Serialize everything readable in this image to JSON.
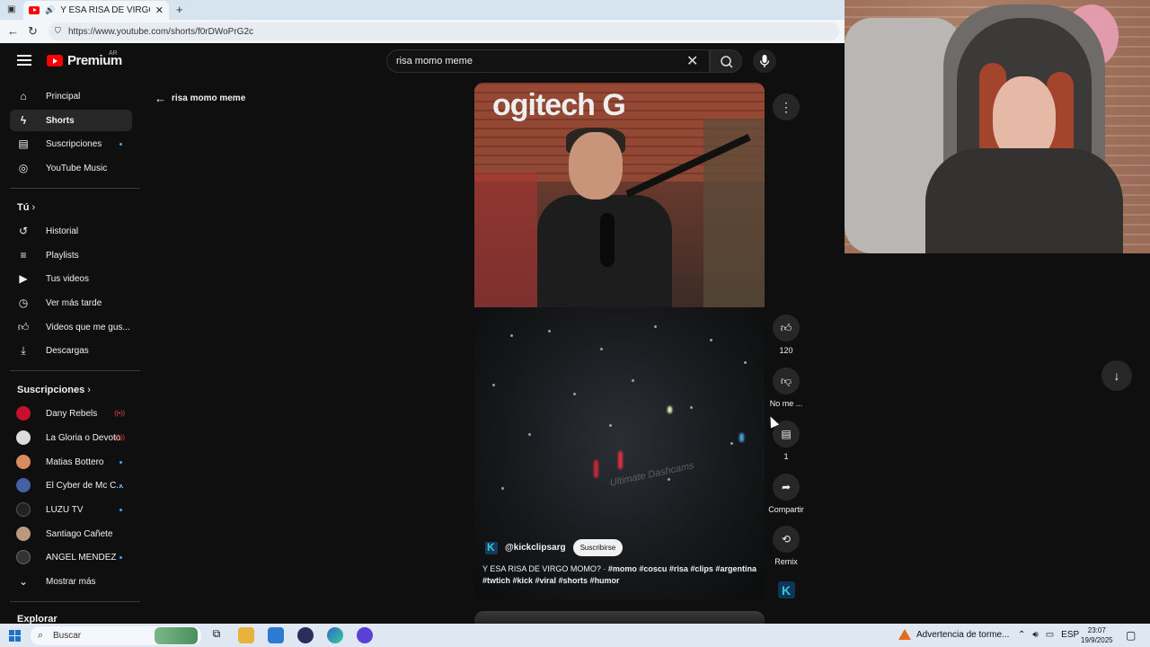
{
  "browser": {
    "tab_title": "Y ESA RISA DE VIRGO M",
    "url": "https://www.youtube.com/shorts/f0rDWoPrG2c"
  },
  "header": {
    "logo_text": "Premium",
    "country_code": "AR",
    "search_value": "risa momo meme"
  },
  "sidebar": {
    "main": [
      {
        "label": "Principal",
        "icon": "home-icon"
      },
      {
        "label": "Shorts",
        "icon": "shorts-icon",
        "active": true
      },
      {
        "label": "Suscripciones",
        "icon": "subscriptions-icon"
      },
      {
        "label": "YouTube Music",
        "icon": "music-icon"
      }
    ],
    "you_heading": "Tú",
    "you": [
      {
        "label": "Historial",
        "icon": "history-icon"
      },
      {
        "label": "Playlists",
        "icon": "playlist-icon"
      },
      {
        "label": "Tus videos",
        "icon": "your-videos-icon"
      },
      {
        "label": "Ver más tarde",
        "icon": "clock-icon"
      },
      {
        "label": "Videos que me gus...",
        "icon": "like-icon"
      },
      {
        "label": "Descargas",
        "icon": "download-icon"
      }
    ],
    "subs_heading": "Suscripciones",
    "subscriptions": [
      {
        "label": "Dany Rebels",
        "live": true,
        "color": "#c8102e"
      },
      {
        "label": "La Gloria o Devoto",
        "live": true,
        "color": "#dcdcdc"
      },
      {
        "label": "Matias Bottero",
        "dot": true,
        "color": "#d98b5f"
      },
      {
        "label": "El Cyber de Mc C...",
        "dot": true,
        "color": "#4660a8"
      },
      {
        "label": "LUZU TV",
        "dot": true,
        "color": "#222222"
      },
      {
        "label": "Santiago Cañete",
        "color": "#b99a80"
      },
      {
        "label": "ANGEL MENDEZ",
        "dot": true,
        "color": "#333333"
      }
    ],
    "show_more": "Mostrar más",
    "explore_heading": "Explorar"
  },
  "back_label": "risa momo meme",
  "short": {
    "brand_text": "ogitech G",
    "watermark": "Ultimate Dashcams",
    "channel_handle": "@kickclipsarg",
    "subscribe_label": "Suscribirse",
    "caption_text": "Y ESA RISA DE VIRGO MOMO? · ",
    "caption_tags": "#momo #coscu #risa #clips #argentina #twtich #kick #viral #shorts #humor"
  },
  "actions": {
    "likes": "120",
    "dislike_label": "No me ...",
    "comments": "1",
    "share_label": "Compartir",
    "remix_label": "Remix"
  },
  "taskbar": {
    "search_label": "Buscar",
    "weather_text": "Advertencia de torme...",
    "lang": "ESP",
    "time": "23:07",
    "date": "19/9/2025"
  }
}
